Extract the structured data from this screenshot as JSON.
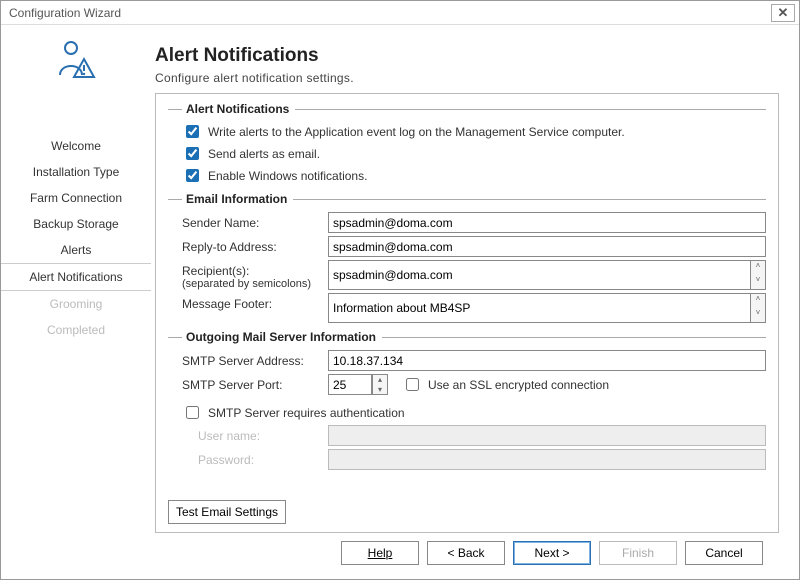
{
  "window": {
    "title": "Configuration Wizard",
    "close_glyph": "✕"
  },
  "nav": {
    "items": [
      {
        "label": "Welcome",
        "state": "normal"
      },
      {
        "label": "Installation Type",
        "state": "normal"
      },
      {
        "label": "Farm Connection",
        "state": "normal"
      },
      {
        "label": "Backup Storage",
        "state": "normal"
      },
      {
        "label": "Alerts",
        "state": "normal"
      },
      {
        "label": "Alert Notifications",
        "state": "selected"
      },
      {
        "label": "Grooming",
        "state": "disabled"
      },
      {
        "label": "Completed",
        "state": "disabled"
      }
    ]
  },
  "page": {
    "title": "Alert Notifications",
    "subtitle": "Configure alert notification settings."
  },
  "groups": {
    "alert": {
      "legend": "Alert Notifications",
      "cb_log": {
        "label": "Write alerts to the Application event log on the Management Service computer.",
        "checked": true
      },
      "cb_email": {
        "label": "Send alerts as email.",
        "checked": true
      },
      "cb_windows": {
        "label": "Enable Windows notifications.",
        "checked": true
      }
    },
    "email": {
      "legend": "Email Information",
      "sender": {
        "label": "Sender Name:",
        "value": "spsadmin@doma.com"
      },
      "replyto": {
        "label": "Reply-to Address:",
        "value": "spsadmin@doma.com"
      },
      "recipients": {
        "label": "Recipient(s):",
        "sublabel": "(separated by semicolons)",
        "value": "spsadmin@doma.com"
      },
      "footer_f": {
        "label": "Message Footer:",
        "value": "Information about MB4SP"
      }
    },
    "smtp": {
      "legend": "Outgoing Mail Server Information",
      "address": {
        "label": "SMTP Server Address:",
        "value": "10.18.37.134"
      },
      "port": {
        "label": "SMTP Server Port:",
        "value": "25"
      },
      "ssl": {
        "label": "Use an SSL encrypted connection",
        "checked": false
      },
      "auth": {
        "label": "SMTP Server requires authentication",
        "checked": false
      },
      "user": {
        "label": "User name:",
        "value": ""
      },
      "pass": {
        "label": "Password:",
        "value": ""
      }
    }
  },
  "buttons": {
    "test": "Test Email Settings",
    "help": "Help",
    "back": "< Back",
    "next": "Next >",
    "finish": "Finish",
    "cancel": "Cancel"
  }
}
